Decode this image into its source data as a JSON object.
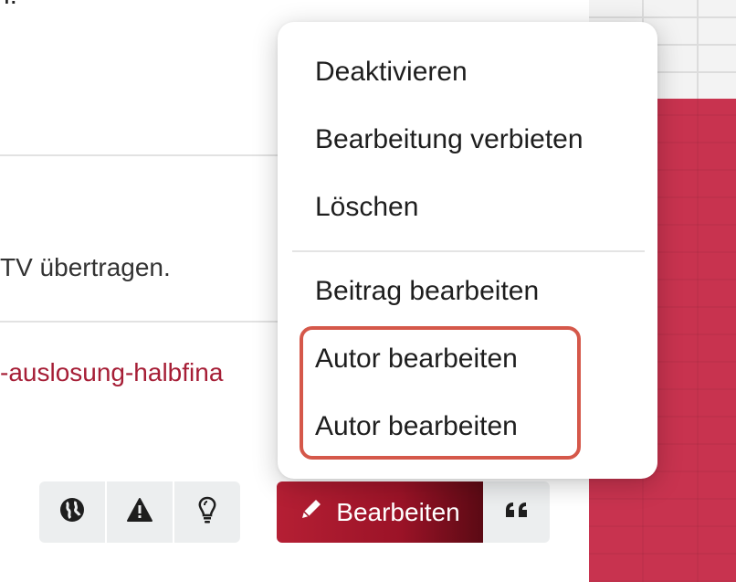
{
  "page": {
    "top_fragment": "n:",
    "body_text": "TV übertragen.",
    "link_text": "-auslosung-halbfina"
  },
  "toolbar": {
    "icons": [
      "globe-icon",
      "warning-icon",
      "lightbulb-icon"
    ],
    "edit_label": "Bearbeiten",
    "edit_icon": "pencil-icon",
    "quote_icon": "quote-icon"
  },
  "menu": {
    "items": [
      {
        "label": "Deaktivieren"
      },
      {
        "label": "Bearbeitung verbieten"
      },
      {
        "label": "Löschen"
      },
      {
        "label": "Beitrag bearbeiten"
      },
      {
        "label": "Autor bearbeiten"
      },
      {
        "label": "Autor bearbeiten"
      }
    ]
  },
  "colors": {
    "accent": "#b51f34",
    "link": "#a61e36",
    "highlight": "#d5584a",
    "wall_red": "#c8334f"
  }
}
